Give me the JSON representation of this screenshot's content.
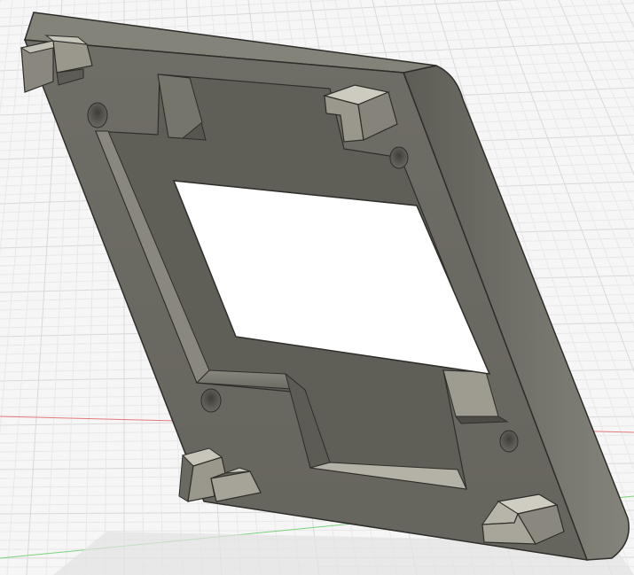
{
  "viewport": {
    "background": "#f6f6f6",
    "grid_color": "#d9d9d9",
    "grid_minor_color": "#e8e8e8",
    "axis_x_color": "#e06a6a",
    "axis_y_color": "#6ccf6c"
  },
  "model": {
    "kind": "3d-printed bracket frame",
    "body_color": "#6c6b63",
    "body_dark_color": "#4f4e47",
    "edge_color": "#7a7970",
    "highlight_color": "#b8b6ac",
    "cutout_color": "#ffffff",
    "mounting_holes": 4,
    "corner_clips": 4
  }
}
